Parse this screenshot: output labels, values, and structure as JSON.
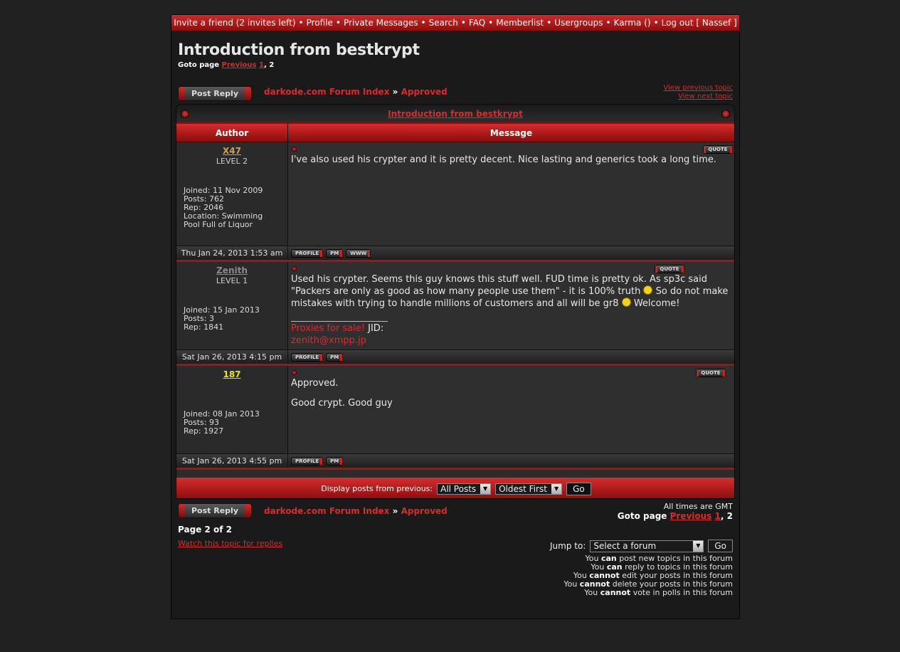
{
  "topnav": {
    "items": [
      "Invite a friend (2 invites left)",
      "Profile",
      "Private Messages",
      "Search",
      "FAQ",
      "Memberlist",
      "Usergroups",
      "Karma ()",
      "Log out [ Nassef ]"
    ]
  },
  "topic": {
    "title": "Introduction from bestkrypt",
    "goto_label": "Goto page",
    "goto_prev": "Previous",
    "goto_page1": "1",
    "goto_page2": "2"
  },
  "post_reply_label": "Post Reply",
  "breadcrumb": {
    "index": "darkode.com Forum Index",
    "sep": "»",
    "forum": "Approved"
  },
  "nav_topics": {
    "prev": "View previous topic",
    "next": "View next topic"
  },
  "table": {
    "header_title": "Introduction from bestkrypt",
    "col_author": "Author",
    "col_message": "Message"
  },
  "posts": [
    {
      "author": "X47",
      "author_color": "#d4a04a",
      "level": "LEVEL 2",
      "joined": "Joined: 11 Nov 2009",
      "posts": "Posts: 762",
      "rep": "Rep: 2046",
      "location1": "Location: Swimming",
      "location2": "Pool Full of Liquor",
      "body": "I've also used his crypter and it is pretty decent. Nice lasting and generics took a long time.",
      "date": "Thu Jan 24, 2013 1:53 am"
    },
    {
      "author": "Zenith",
      "author_color": "#8a8a8a",
      "level": "LEVEL 1",
      "joined": "Joined: 15 Jan 2013",
      "posts": "Posts: 3",
      "rep": "Rep: 1841",
      "body1": "Used his crypter. Seems this guy knows this stuff well. FUD time is pretty ok. As sp3c said",
      "body2": "\"Packers are only as good as how many people use them\" - it is 100% truth",
      "body3": "So do not make",
      "body4": "mistakes with trying to handle millions of customers and all will be gr8",
      "body5": "Welcome!",
      "sig_red": "Proxies for sale!",
      "sig_jid": "JID:",
      "sig_mail": "zenith@xmpp.jp",
      "date": "Sat Jan 26, 2013 4:15 pm"
    },
    {
      "author": "187",
      "author_color": "#e6e600",
      "joined": "Joined: 08 Jan 2013",
      "posts": "Posts: 93",
      "rep": "Rep: 1927",
      "body1": "Approved.",
      "body2": "Good crypt. Good guy",
      "date": "Sat Jan 26, 2013 4:55 pm"
    }
  ],
  "buttons": {
    "quote": "QUOTE",
    "profile": "PROFILE",
    "pm": "PM",
    "www": "WWW"
  },
  "display_bar": {
    "label": "Display posts from previous:",
    "select1": "All Posts",
    "select2": "Oldest First",
    "go": "Go"
  },
  "footer": {
    "timezone": "All times are GMT",
    "page_of": "Page 2 of 2",
    "watch": "Watch this topic for replies",
    "jump_label": "Jump to:",
    "jump_select": "Select a forum",
    "jump_go": "Go"
  },
  "permissions": [
    {
      "pre": "You",
      "verb": "can",
      "post": "post new topics in this forum"
    },
    {
      "pre": "You",
      "verb": "can",
      "post": "reply to topics in this forum"
    },
    {
      "pre": "You",
      "verb": "cannot",
      "post": "edit your posts in this forum"
    },
    {
      "pre": "You",
      "verb": "cannot",
      "post": "delete your posts in this forum"
    },
    {
      "pre": "You",
      "verb": "cannot",
      "post": "vote in polls in this forum"
    }
  ]
}
